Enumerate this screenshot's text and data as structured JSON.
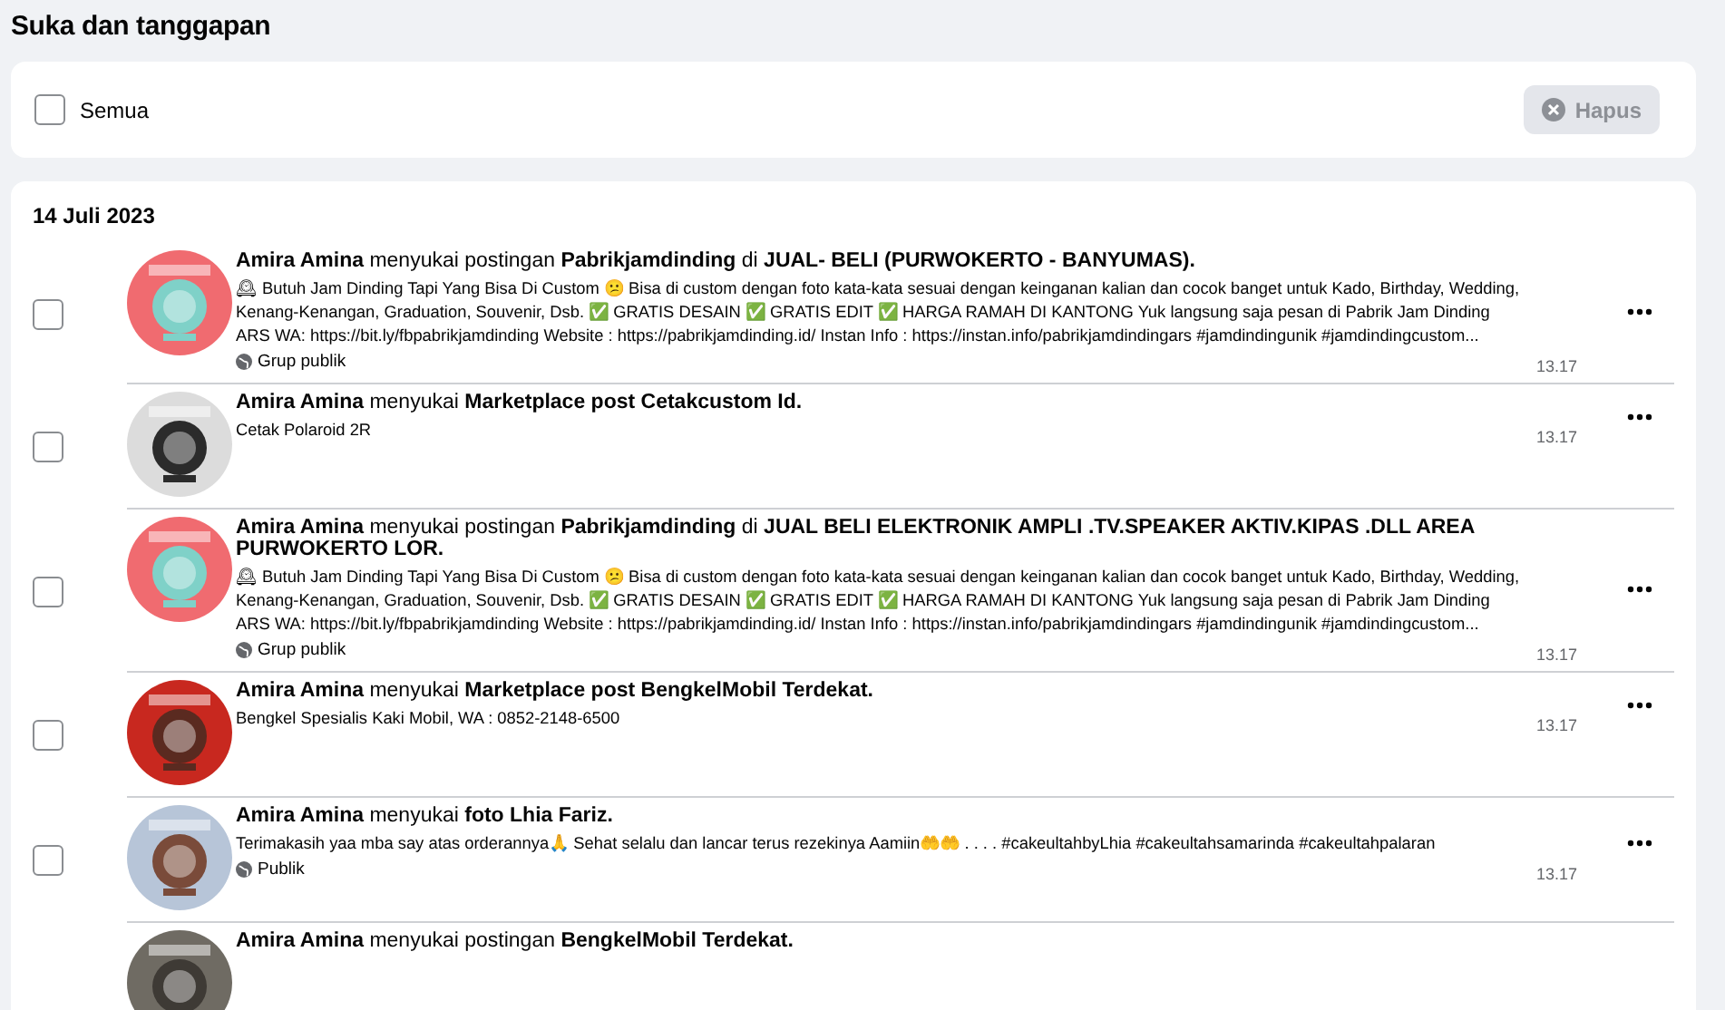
{
  "page_title": "Suka dan tanggapan",
  "toolbar": {
    "select_all": {
      "label": "Semua",
      "checked": false
    },
    "delete_button": {
      "label": "Hapus",
      "disabled": true
    }
  },
  "groups": [
    {
      "date": "14 Juli 2023",
      "items": [
        {
          "selected": false,
          "title": "**Amira Amina** menyukai postingan **Pabrikjamdinding** di **JUAL- BELI (PURWOKERTO - BANYUMAS).**",
          "description": "🕰 Butuh Jam Dinding Tapi Yang Bisa Di Custom 😕 Bisa di custom dengan foto kata-kata sesuai dengan keinganan kalian dan cocok banget untuk Kado, Birthday, Wedding, Kenang-Kenangan, Graduation, Souvenir, Dsb. ✅ GRATIS DESAIN ✅ GRATIS EDIT ✅ HARGA RAMAH DI KANTONG Yuk langsung saja pesan di Pabrik Jam Dinding ARS WA: https://bit.ly/fbpabrikjamdinding Website : https://pabrikjamdinding.id/ Instan Info : https://instan.info/pabrikjamdindingars #jamdindingunik #jamdindingcustom...",
          "audience": "Grup publik",
          "time": "13.17"
        },
        {
          "selected": false,
          "title": "**Amira Amina** menyukai **Marketplace post Cetakcustom Id.**",
          "description": "Cetak Polaroid 2R",
          "time": "13.17"
        },
        {
          "selected": false,
          "title": "**Amira Amina** menyukai postingan **Pabrikjamdinding** di **JUAL BELI ELEKTRONIK AMPLI .TV.SPEAKER AKTIV.KIPAS .DLL AREA PURWOKERTO LOR.**",
          "description": "🕰 Butuh Jam Dinding Tapi Yang Bisa Di Custom 😕 Bisa di custom dengan foto kata-kata sesuai dengan keinganan kalian dan cocok banget untuk Kado, Birthday, Wedding, Kenang-Kenangan, Graduation, Souvenir, Dsb. ✅ GRATIS DESAIN ✅ GRATIS EDIT ✅ HARGA RAMAH DI KANTONG Yuk langsung saja pesan di Pabrik Jam Dinding ARS WA: https://bit.ly/fbpabrikjamdinding Website : https://pabrikjamdinding.id/ Instan Info : https://instan.info/pabrikjamdindingars #jamdindingunik #jamdindingcustom...",
          "audience": "Grup publik",
          "time": "13.17"
        },
        {
          "selected": false,
          "title": "**Amira Amina** menyukai **Marketplace post BengkelMobil Terdekat.**",
          "description": "Bengkel Spesialis Kaki Mobil, WA : 0852-2148-6500",
          "time": "13.17"
        },
        {
          "selected": false,
          "title": "**Amira Amina** menyukai **foto Lhia Fariz.**",
          "description": "Terimakasih yaa mba say atas orderannya🙏 Sehat selalu dan lancar terus rezekinya Aamiin🤲🤲 . . . . #cakeultahbyLhia #cakeultahsamarinda #cakeultahpalaran",
          "audience": "Publik",
          "time": "13.17"
        },
        {
          "title": "**Amira Amina** menyukai postingan **BengkelMobil Terdekat.**"
        }
      ]
    }
  ]
}
